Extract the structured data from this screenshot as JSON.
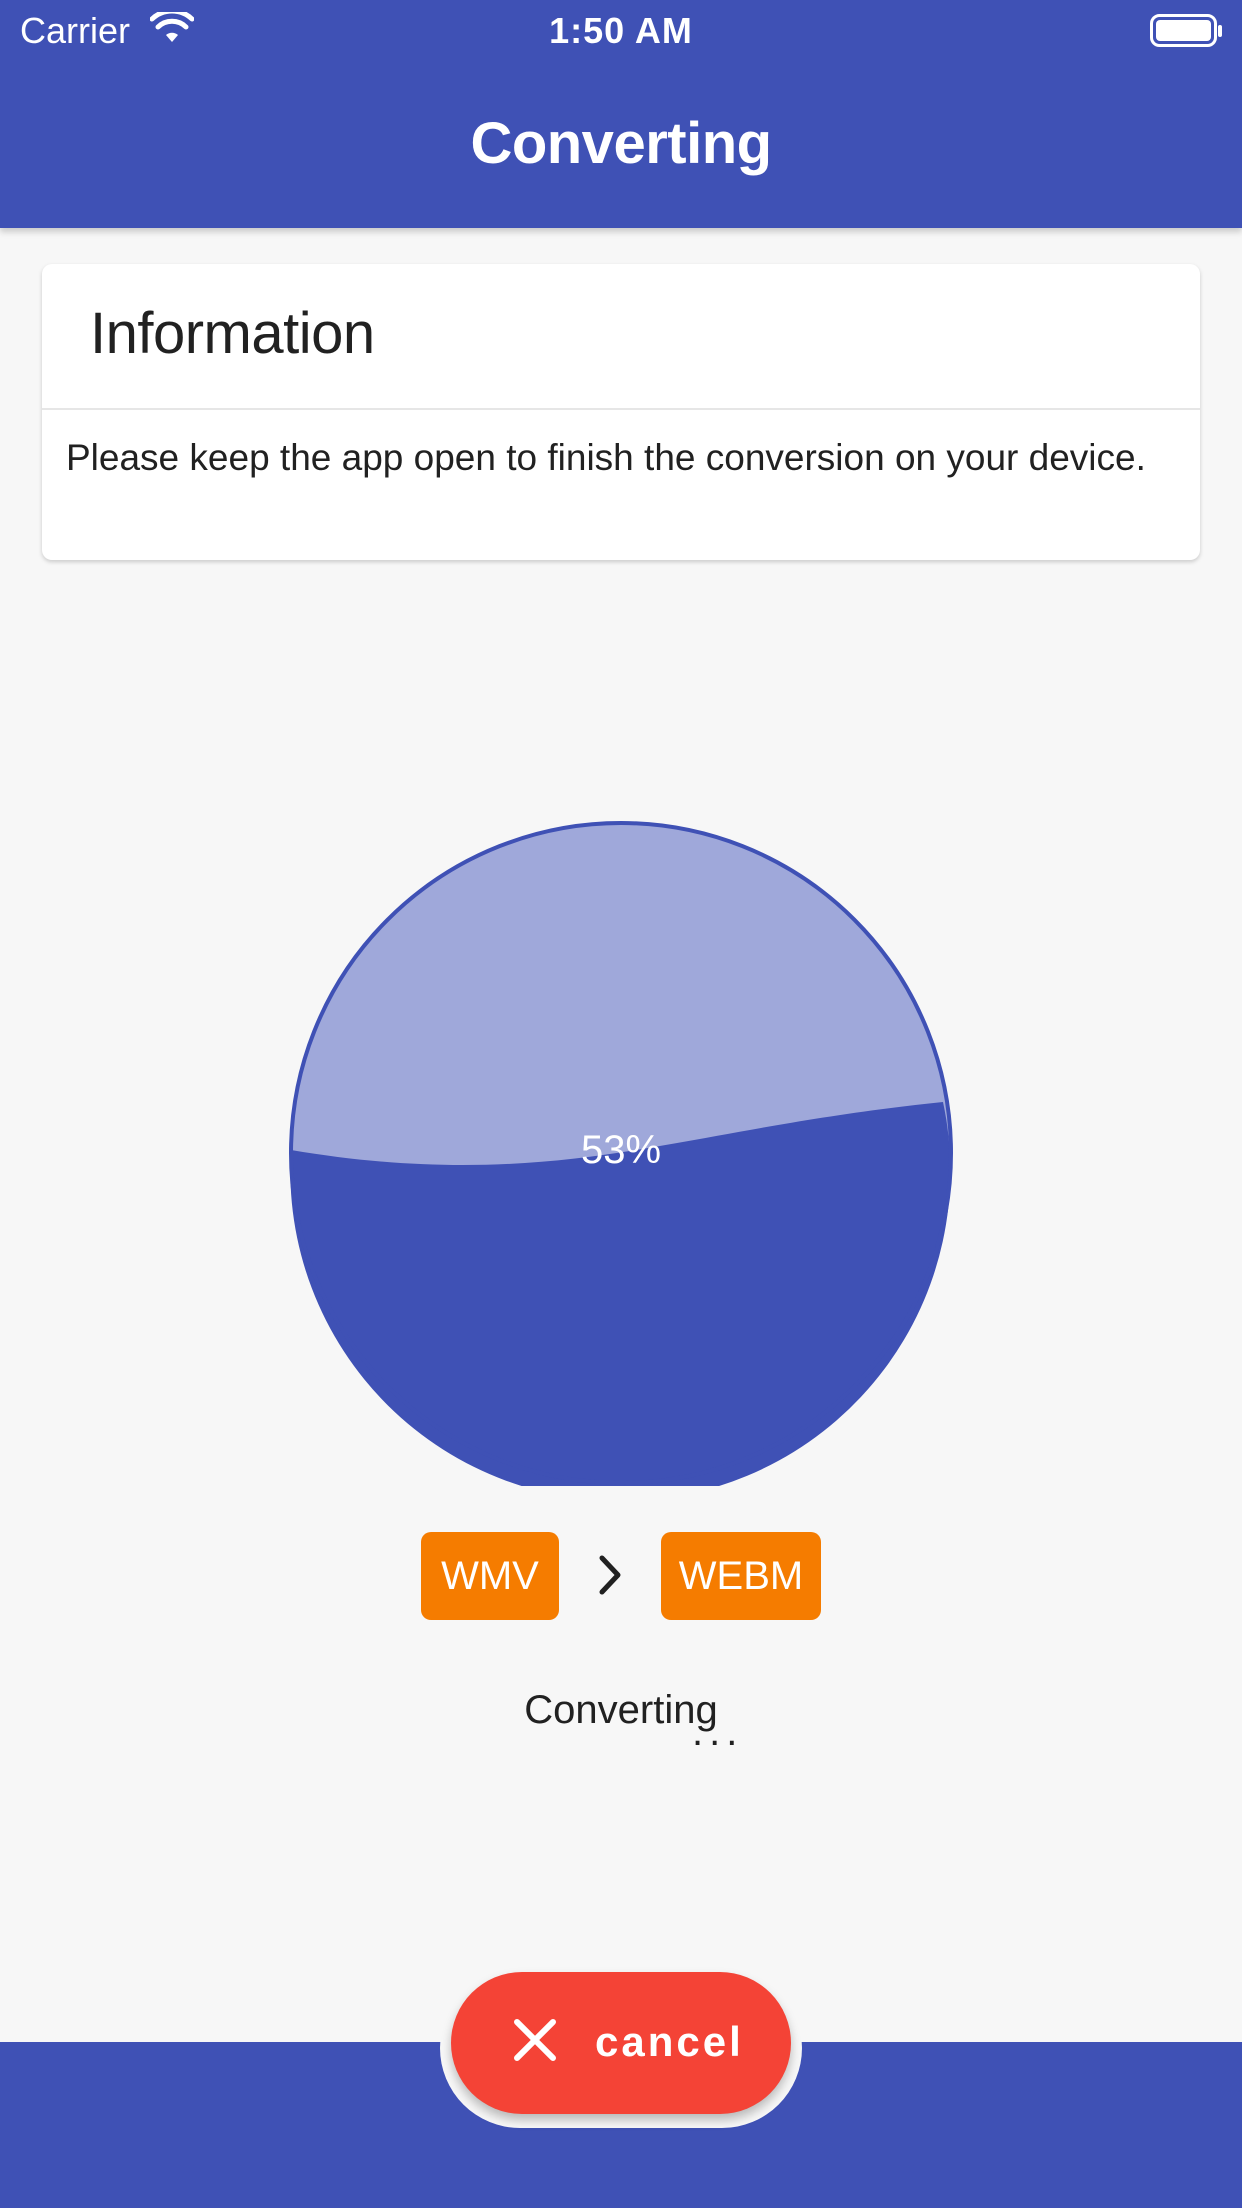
{
  "status_bar": {
    "carrier": "Carrier",
    "time": "1:50 AM"
  },
  "app_bar": {
    "title": "Converting"
  },
  "info_card": {
    "title": "Information",
    "body": "Please keep the app open to finish the conversion on your device."
  },
  "progress": {
    "percent_label": "53%",
    "value": 0.53
  },
  "conversion": {
    "from_format": "WMV",
    "to_format": "WEBM",
    "status": "Converting",
    "status_dots": "..."
  },
  "cancel_button": {
    "label": "cancel",
    "icon": "close-icon"
  },
  "colors": {
    "primary": "#3f51b5",
    "accent": "#f57c00",
    "cancel": "#f44336",
    "pie_light": "#9fa8da"
  }
}
